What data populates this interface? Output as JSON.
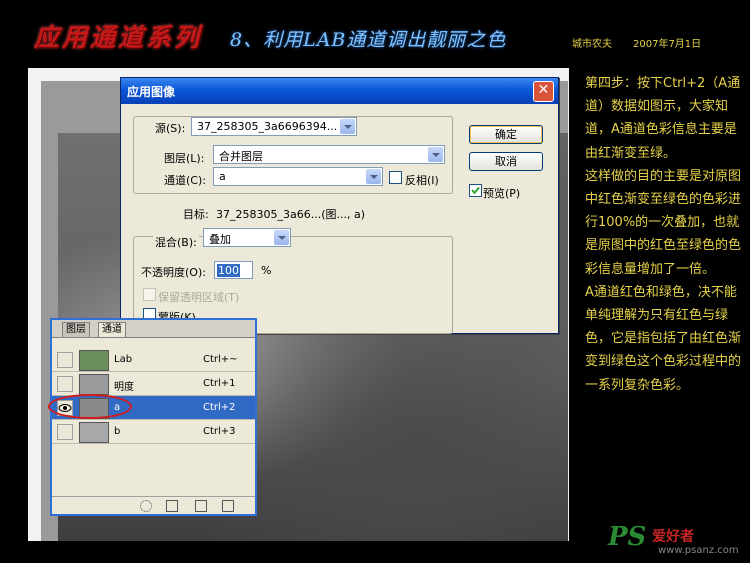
{
  "header": {
    "series": "应用通道系列",
    "title": "8、利用LAB通道调出靓丽之色",
    "author": "城市农夫",
    "date": "2007年7月1日"
  },
  "dialog": {
    "title": "应用图像",
    "close_glyph": "✕",
    "source_label": "源(S):",
    "source_value": "37_258305_3a6696394...",
    "layer_label": "图层(L):",
    "layer_value": "合并图层",
    "channel_label": "通道(C):",
    "channel_value": "a",
    "invert_label": "反相(I)",
    "target_label": "目标:",
    "target_value": "37_258305_3a66...(图..., a)",
    "blending_label": "混合(B):",
    "blending_value": "叠加",
    "opacity_label": "不透明度(O):",
    "opacity_value": "100",
    "opacity_unit": "%",
    "preserve_label": "保留透明区域(T)",
    "mask_label": "蒙版(K)...",
    "ok_label": "确定",
    "cancel_label": "取消",
    "preview_label": "预览(P)",
    "preview_checked": true
  },
  "channels_panel": {
    "tabs": [
      "图层",
      "通道"
    ],
    "rows": [
      {
        "name": "Lab",
        "shortcut": "Ctrl+~",
        "thumb_color": "#6a8f5a"
      },
      {
        "name": "明度",
        "shortcut": "Ctrl+1",
        "thumb_color": "#9a9a9a"
      },
      {
        "name": "a",
        "shortcut": "Ctrl+2",
        "thumb_color": "#8a8a8a"
      },
      {
        "name": "b",
        "shortcut": "Ctrl+3",
        "thumb_color": "#a8a8a8"
      }
    ]
  },
  "side_text": {
    "p1": "第四步：按下Ctrl+2（A通道）数据如图示，大家知道，A通道色彩信息主要是由红渐变至绿。",
    "p2": "这样做的目的主要是对原图中红色渐变至绿色的色彩进行100%的一次叠加，也就是原图中的红色至绿色的色彩信息量增加了一倍。",
    "p3": "A通道红色和绿色，决不能单纯理解为只有红色与绿色，它是指包括了由红色渐变到绿色这个色彩过程中的一系列复杂色彩。"
  },
  "watermark": {
    "logo": "PS",
    "site_name": "爱好者",
    "url": "www.psanz.com"
  }
}
